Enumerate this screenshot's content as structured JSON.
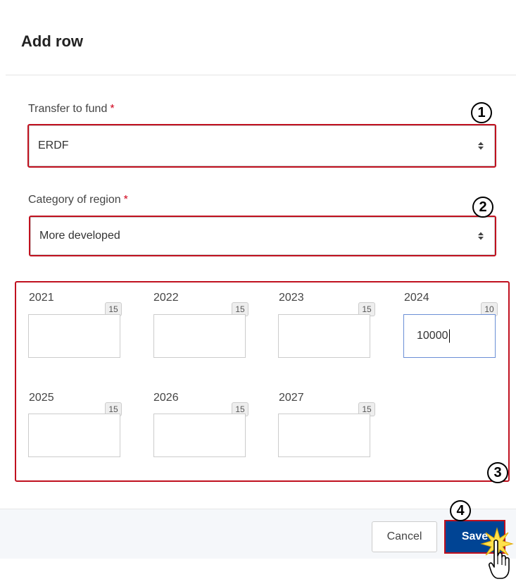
{
  "dialog": {
    "title": "Add row"
  },
  "fund": {
    "label": "Transfer to fund",
    "required_mark": "*",
    "value": "ERDF",
    "callout": "1"
  },
  "region": {
    "label": "Category of region",
    "required_mark": "*",
    "value": "More developed",
    "callout": "2"
  },
  "years": {
    "callout": "3",
    "items": [
      {
        "year": "2021",
        "counter": "15",
        "value": ""
      },
      {
        "year": "2022",
        "counter": "15",
        "value": ""
      },
      {
        "year": "2023",
        "counter": "15",
        "value": ""
      },
      {
        "year": "2024",
        "counter": "10",
        "value": "10000"
      },
      {
        "year": "2025",
        "counter": "15",
        "value": ""
      },
      {
        "year": "2026",
        "counter": "15",
        "value": ""
      },
      {
        "year": "2027",
        "counter": "15",
        "value": ""
      }
    ]
  },
  "footer": {
    "cancel_label": "Cancel",
    "save_label": "Save",
    "callout": "4"
  },
  "colors": {
    "primary": "#004494",
    "highlight": "#c0111f",
    "required": "#d0021b"
  },
  "icons": {
    "select_arrow": "sort-arrows-icon",
    "cursor": "hand-pointer-icon"
  }
}
